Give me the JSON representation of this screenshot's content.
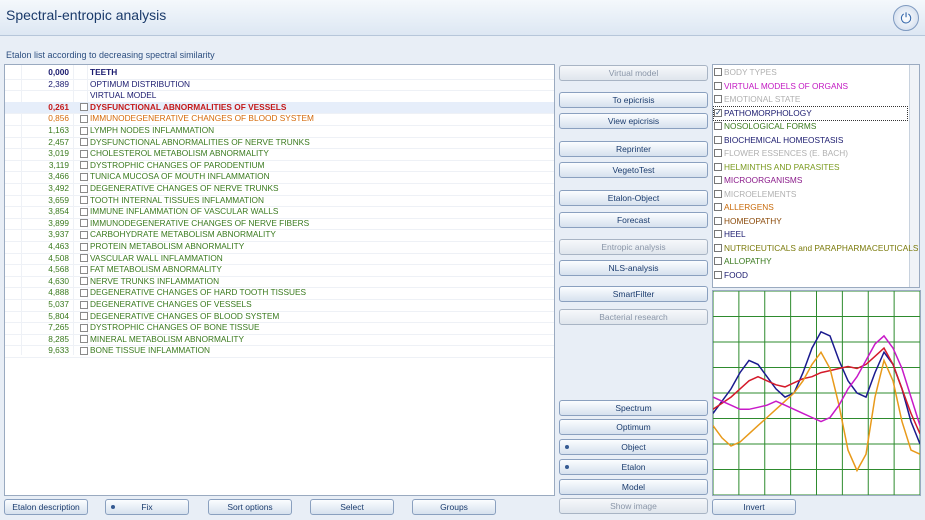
{
  "window": {
    "title": "Spectral-entropic analysis"
  },
  "subtitle": "Etalon list according to decreasing spectral similarity",
  "colors": {
    "green": "#3a7a1e",
    "navy": "#1a1a6e",
    "red": "#c41a1a",
    "orange": "#d46a0a"
  },
  "etalon_rows": [
    {
      "value": "0,000",
      "label": "TEETH",
      "color": "navy",
      "checkbox": false,
      "bold": true
    },
    {
      "value": "2,389",
      "label": "OPTIMUM DISTRIBUTION",
      "color": "navy",
      "checkbox": false,
      "bold": false
    },
    {
      "value": "",
      "label": "VIRTUAL MODEL",
      "color": "navy",
      "checkbox": false,
      "bold": false
    },
    {
      "value": "0,261",
      "label": "DYSFUNCTIONAL ABNORMALITIES OF VESSELS",
      "color": "red",
      "checkbox": true,
      "bold": true
    },
    {
      "value": "0,856",
      "label": "IMMUNODEGENERATIVE CHANGES OF BLOOD SYSTEM",
      "color": "orange",
      "checkbox": true,
      "bold": false
    },
    {
      "value": "1,163",
      "label": "LYMPH NODES INFLAMMATION",
      "color": "green",
      "checkbox": true,
      "bold": false
    },
    {
      "value": "2,457",
      "label": "DYSFUNCTIONAL ABNORMALITIES OF NERVE TRUNKS",
      "color": "green",
      "checkbox": true,
      "bold": false
    },
    {
      "value": "3,019",
      "label": "CHOLESTEROL METABOLISM ABNORMALITY",
      "color": "green",
      "checkbox": true,
      "bold": false
    },
    {
      "value": "3,119",
      "label": "DYSTROPHIC CHANGES OF PARODENTIUM",
      "color": "green",
      "checkbox": true,
      "bold": false
    },
    {
      "value": "3,466",
      "label": "TUNICA MUCOSA OF MOUTH INFLAMMATION",
      "color": "green",
      "checkbox": true,
      "bold": false
    },
    {
      "value": "3,492",
      "label": "DEGENERATIVE CHANGES OF NERVE TRUNKS",
      "color": "green",
      "checkbox": true,
      "bold": false
    },
    {
      "value": "3,659",
      "label": "TOOTH INTERNAL TISSUES INFLAMMATION",
      "color": "green",
      "checkbox": true,
      "bold": false
    },
    {
      "value": "3,854",
      "label": "IMMUNE INFLAMMATION OF VASCULAR WALLS",
      "color": "green",
      "checkbox": true,
      "bold": false
    },
    {
      "value": "3,899",
      "label": "IMMUNODEGENERATIVE CHANGES OF NERVE FIBERS",
      "color": "green",
      "checkbox": true,
      "bold": false
    },
    {
      "value": "3,937",
      "label": "CARBOHYDRATE METABOLISM ABNORMALITY",
      "color": "green",
      "checkbox": true,
      "bold": false
    },
    {
      "value": "4,463",
      "label": "PROTEIN METABOLISM ABNORMALITY",
      "color": "green",
      "checkbox": true,
      "bold": false
    },
    {
      "value": "4,508",
      "label": "VASCULAR WALL INFLAMMATION",
      "color": "green",
      "checkbox": true,
      "bold": false
    },
    {
      "value": "4,568",
      "label": "FAT METABOLISM ABNORMALITY",
      "color": "green",
      "checkbox": true,
      "bold": false
    },
    {
      "value": "4,630",
      "label": "NERVE TRUNKS INFLAMMATION",
      "color": "green",
      "checkbox": true,
      "bold": false
    },
    {
      "value": "4,888",
      "label": "DEGENERATIVE CHANGES OF HARD TOOTH TISSUES",
      "color": "green",
      "checkbox": true,
      "bold": false
    },
    {
      "value": "5,037",
      "label": "DEGENERATIVE CHANGES OF VESSELS",
      "color": "green",
      "checkbox": true,
      "bold": false
    },
    {
      "value": "5,804",
      "label": "DEGENERATIVE CHANGES OF BLOOD SYSTEM",
      "color": "green",
      "checkbox": true,
      "bold": false
    },
    {
      "value": "7,265",
      "label": "DYSTROPHIC CHANGES OF BONE TISSUE",
      "color": "green",
      "checkbox": true,
      "bold": false
    },
    {
      "value": "8,285",
      "label": "MINERAL METABOLISM ABNORMALITY",
      "color": "green",
      "checkbox": true,
      "bold": false
    },
    {
      "value": "9,633",
      "label": "BONE TISSUE INFLAMMATION",
      "color": "green",
      "checkbox": true,
      "bold": false
    }
  ],
  "middle_buttons": {
    "virtual_model": "Virtual model",
    "to_epicrisis": "To epicrisis",
    "view_epicrisis": "View epicrisis",
    "reprinter": "Reprinter",
    "vegetotest": "VegetoTest",
    "etalon_object": "Etalon-Object",
    "forecast": "Forecast",
    "entropic_analysis": "Entropic analysis",
    "nls_analysis": "NLS-analysis",
    "smartfilter": "SmartFilter",
    "bacterial_research": "Bacterial research",
    "spectrum": "Spectrum",
    "optimum": "Optimum",
    "object": "Object",
    "etalon": "Etalon",
    "model": "Model",
    "show_image": "Show image"
  },
  "categories": [
    {
      "label": "BODY TYPES",
      "color": "#b0b0b0",
      "checked": false
    },
    {
      "label": "VIRTUAL MODELS OF ORGANS",
      "color": "#c218c2",
      "checked": false
    },
    {
      "label": "EMOTIONAL STATE",
      "color": "#b0b0b0",
      "checked": false
    },
    {
      "label": "PATHOMORPHOLOGY",
      "color": "#1a1a6e",
      "checked": true
    },
    {
      "label": "NOSOLOGICAL FORMS",
      "color": "#3a7a1e",
      "checked": false
    },
    {
      "label": "BIOCHEMICAL HOMEOSTASIS",
      "color": "#1a1a6e",
      "checked": false
    },
    {
      "label": "FLOWER ESSENCES (E. BACH)",
      "color": "#b0b0b0",
      "checked": false
    },
    {
      "label": "HELMINTHS AND PARASITES",
      "color": "#7a9a1e",
      "checked": false
    },
    {
      "label": "MICROORGANISMS",
      "color": "#8a1a8a",
      "checked": false
    },
    {
      "label": "MICROELEMENTS",
      "color": "#b0b0b0",
      "checked": false
    },
    {
      "label": "ALLERGENS",
      "color": "#c86a0a",
      "checked": false
    },
    {
      "label": "HOMEOPATHY",
      "color": "#8a4a0a",
      "checked": false
    },
    {
      "label": "HEEL",
      "color": "#1a1a6e",
      "checked": false
    },
    {
      "label": "NUTRICEUTICALS and PARAPHARMACEUTICALS",
      "color": "#7a7a0a",
      "checked": false
    },
    {
      "label": "ALLOPATHY",
      "color": "#3a7a1e",
      "checked": false
    },
    {
      "label": "FOOD",
      "color": "#1a1a6e",
      "checked": false
    }
  ],
  "bottom_buttons": {
    "etalon_description": "Etalon description",
    "fix": "Fix",
    "sort_options": "Sort options",
    "select": "Select",
    "groups": "Groups",
    "invert": "Invert"
  },
  "graph_series": {
    "navy": {
      "color": "#1a1a8e",
      "values": [
        0.4,
        0.46,
        0.52,
        0.6,
        0.66,
        0.64,
        0.58,
        0.52,
        0.48,
        0.5,
        0.6,
        0.72,
        0.8,
        0.78,
        0.66,
        0.56,
        0.5,
        0.48,
        0.6,
        0.7,
        0.64,
        0.52,
        0.36,
        0.25
      ]
    },
    "red": {
      "color": "#d41a2a",
      "values": [
        0.42,
        0.45,
        0.48,
        0.52,
        0.56,
        0.58,
        0.56,
        0.54,
        0.53,
        0.55,
        0.57,
        0.58,
        0.6,
        0.61,
        0.62,
        0.63,
        0.62,
        0.64,
        0.68,
        0.72,
        0.64,
        0.52,
        0.4,
        0.3
      ]
    },
    "orange": {
      "color": "#e89a1a",
      "values": [
        0.34,
        0.28,
        0.24,
        0.26,
        0.3,
        0.34,
        0.38,
        0.42,
        0.46,
        0.5,
        0.56,
        0.64,
        0.7,
        0.62,
        0.44,
        0.22,
        0.12,
        0.2,
        0.48,
        0.66,
        0.56,
        0.36,
        0.22,
        0.2
      ]
    },
    "magenta": {
      "color": "#c81ac8",
      "values": [
        0.48,
        0.46,
        0.44,
        0.42,
        0.42,
        0.43,
        0.44,
        0.46,
        0.44,
        0.42,
        0.4,
        0.38,
        0.36,
        0.38,
        0.44,
        0.52,
        0.58,
        0.66,
        0.74,
        0.78,
        0.72,
        0.62,
        0.48,
        0.34
      ]
    }
  }
}
